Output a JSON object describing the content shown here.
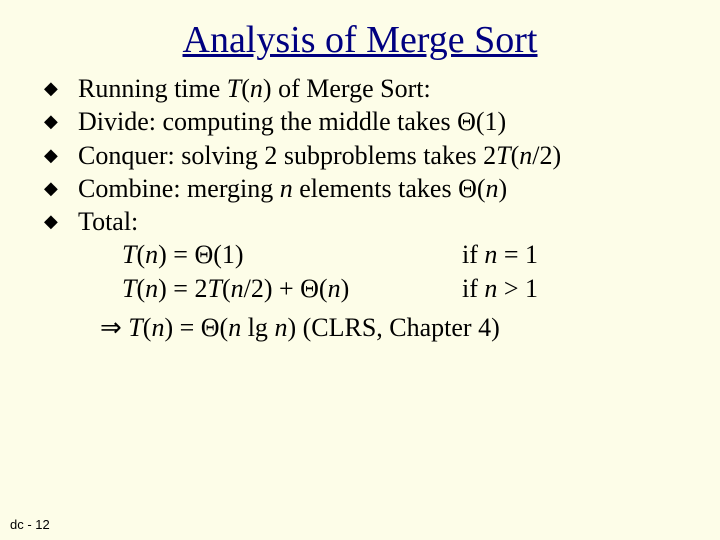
{
  "title": "Analysis of Merge Sort",
  "bullets": {
    "b1_pre": "Running time ",
    "b1_T": "T",
    "b1_lp": "(",
    "b1_n": "n",
    "b1_rp": ")",
    "b1_post": " of Merge Sort:",
    "b2": "Divide: computing the middle takes Θ(1)",
    "b3_pre": "Conquer: solving 2 subproblems takes 2",
    "b3_T": "T",
    "b3_lp": "(",
    "b3_n": "n",
    "b3_post": "/2)",
    "b4_pre": "Combine: merging ",
    "b4_n1": "n",
    "b4_mid": " elements takes Θ(",
    "b4_n2": "n",
    "b4_post": ")",
    "b5": "Total:"
  },
  "eq": {
    "l1_T": "T",
    "l1_lp": "(",
    "l1_n": "n",
    "l1_post": ") = Θ(1)",
    "l1_if": "if ",
    "l1_nr": "n",
    "l1_cond": " = 1",
    "l2_T": "T",
    "l2_lp": "(",
    "l2_n": "n",
    "l2_mid1": ") = 2",
    "l2_T2": "T",
    "l2_lp2": "(",
    "l2_n2": "n",
    "l2_mid2": "/2) + Θ(",
    "l2_n3": "n",
    "l2_rp": ")",
    "l2_if": "if ",
    "l2_nr": "n",
    "l2_cond": " > 1"
  },
  "concl": {
    "arrow": "⇒ ",
    "T": "T",
    "lp": "(",
    "n": "n",
    "mid1": ") = Θ(",
    "n2": "n",
    "lg": " lg ",
    "n3": "n",
    "post": ")  (CLRS, Chapter 4)"
  },
  "footer": "dc - 12"
}
